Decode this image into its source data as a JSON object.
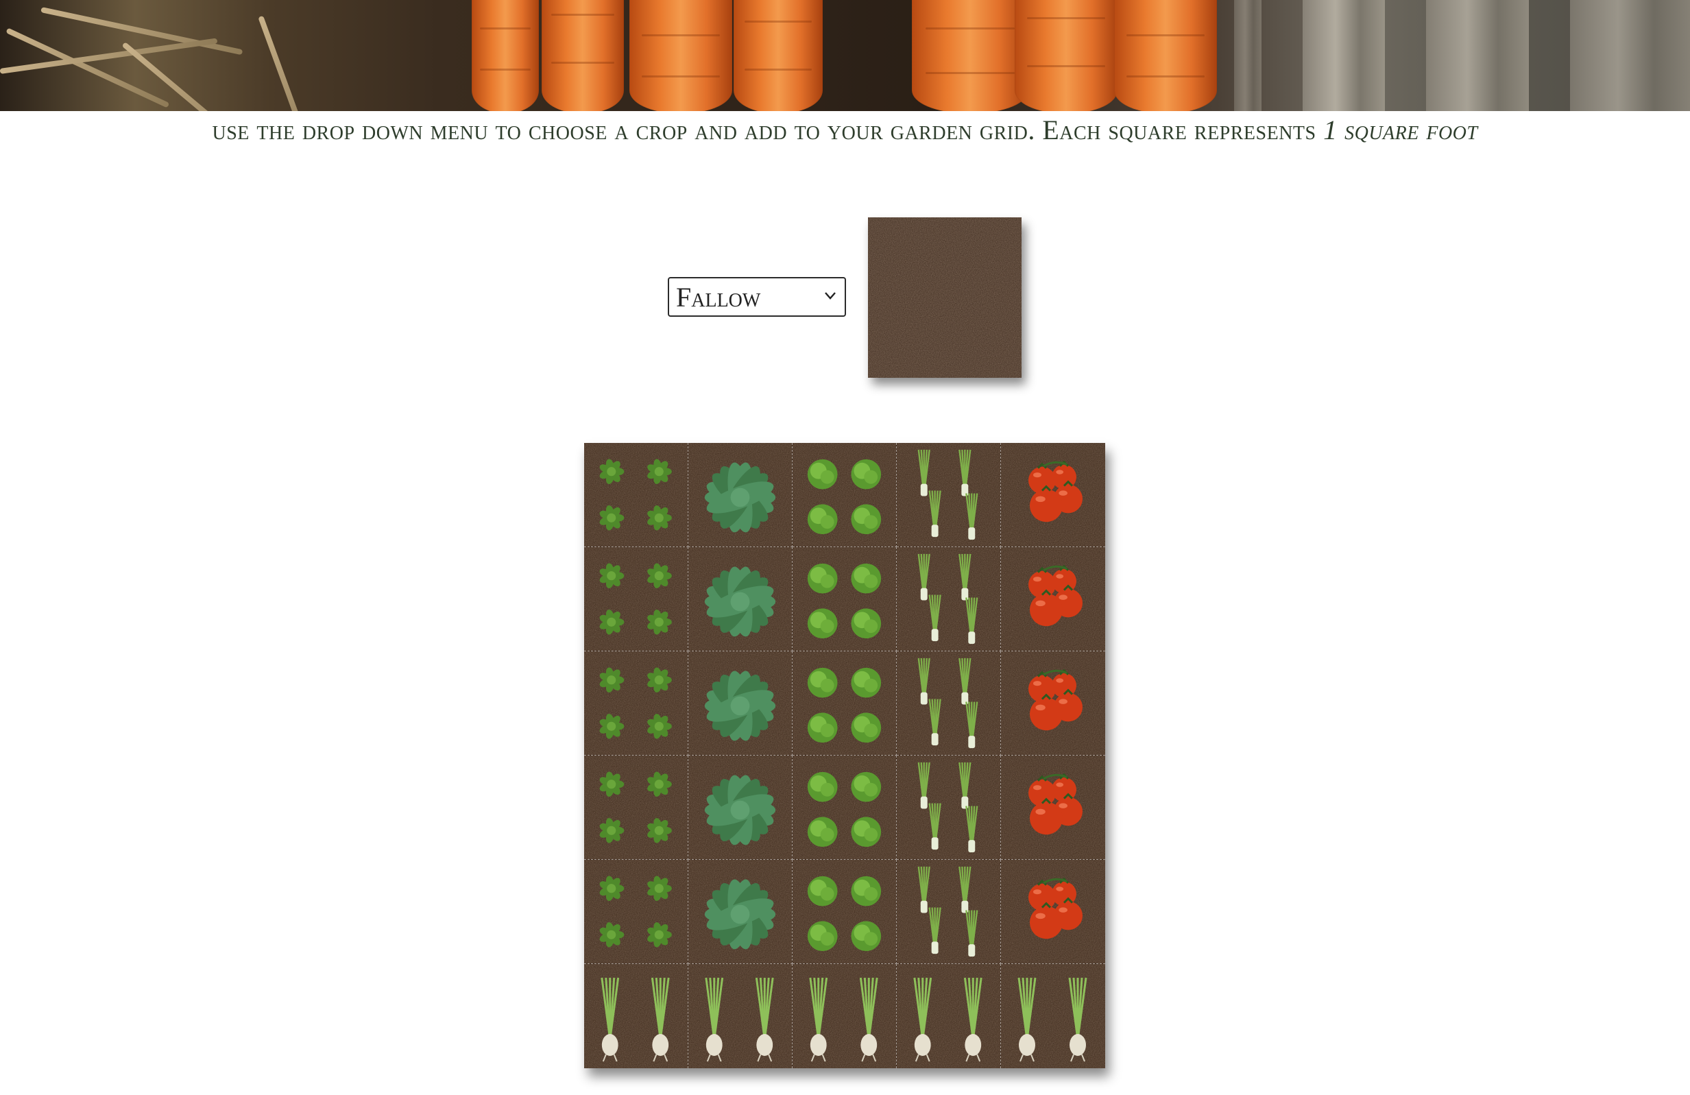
{
  "instructions": {
    "main": "use the drop down menu to choose a crop and add to your garden grid. Each square represents ",
    "emphasis": "1 square foot"
  },
  "crop_selector": {
    "selected": "Fallow",
    "chevron_icon": "chevron-down-icon"
  },
  "preview": {
    "icon": "soil-swatch",
    "crop": "fallow"
  },
  "colors": {
    "text": "#2e3d2c",
    "soil": "#3a2618",
    "leaf": "#4f8a2b",
    "kale": "#3f7a4a",
    "tomato": "#d33a16"
  },
  "grid": {
    "columns": 5,
    "rows": [
      [
        "greens",
        "kale",
        "lettuce",
        "chives",
        "tomato"
      ],
      [
        "greens",
        "kale",
        "lettuce",
        "chives",
        "tomato"
      ],
      [
        "greens",
        "kale",
        "lettuce",
        "chives",
        "tomato"
      ],
      [
        "greens",
        "kale",
        "lettuce",
        "chives",
        "tomato"
      ],
      [
        "greens",
        "kale",
        "lettuce",
        "chives",
        "tomato"
      ],
      [
        "onion",
        "onion",
        "onion",
        "onion",
        "onion"
      ]
    ]
  }
}
